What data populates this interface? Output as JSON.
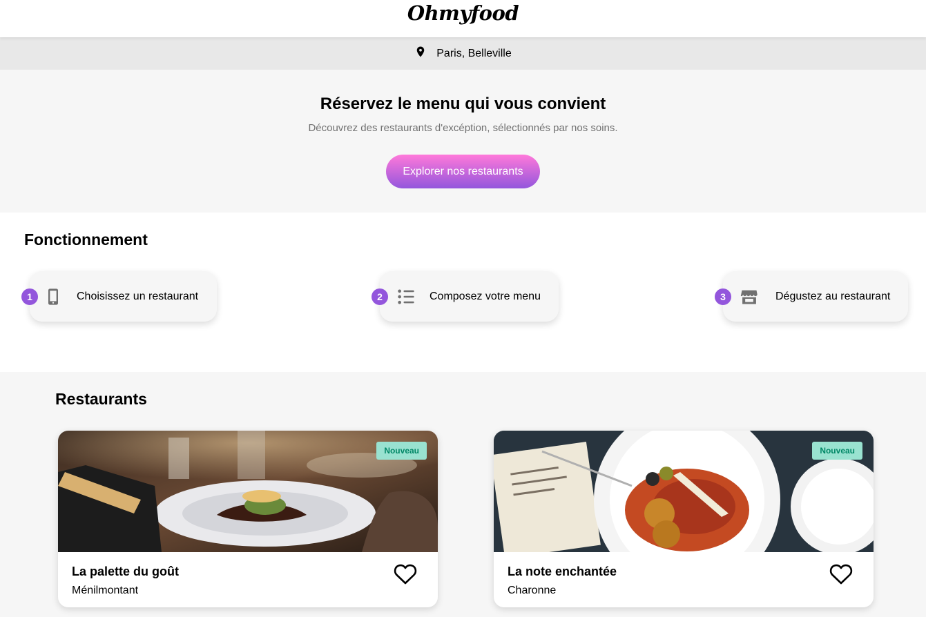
{
  "header": {
    "logo": "Ohmyfood"
  },
  "location": {
    "icon": "map-pin-icon",
    "text": "Paris, Belleville"
  },
  "hero": {
    "title": "Réservez le menu qui vous convient",
    "subtitle": "Découvrez des restaurants d'excéption, sélectionnés par nos soins.",
    "button_label": "Explorer nos restaurants"
  },
  "how": {
    "title": "Fonctionnement",
    "steps": [
      {
        "number": "1",
        "icon": "smartphone-icon",
        "label": "Choisissez un restaurant"
      },
      {
        "number": "2",
        "icon": "list-icon",
        "label": "Composez votre menu"
      },
      {
        "number": "3",
        "icon": "store-icon",
        "label": "Dégustez au restaurant"
      }
    ]
  },
  "restaurants": {
    "title": "Restaurants",
    "items": [
      {
        "name": "La palette du goût",
        "area": "Ménilmontant",
        "badge": "Nouveau",
        "image": "plated-fish-dish-photo"
      },
      {
        "name": "La note enchantée",
        "area": "Charonne",
        "badge": "Nouveau",
        "image": "croquettes-plate-photo"
      }
    ]
  },
  "colors": {
    "accent": "#9356dc",
    "button_top": "#ff79da",
    "badge_bg": "#99e2d0",
    "badge_text": "#008766",
    "light_bg": "#f6f6f6"
  }
}
